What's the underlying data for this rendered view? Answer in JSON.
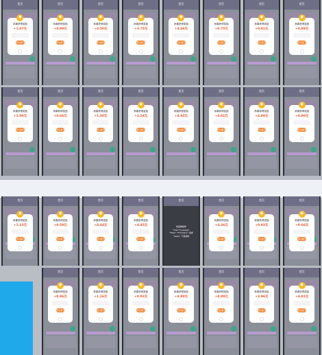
{
  "colors": {
    "bg": "#b9bdc4",
    "tile": "#8a8f99",
    "header": "#6e6f86",
    "card": "#ffffff",
    "amount": "#e8542b",
    "button": "#f28b3a",
    "coin": "#f7b928",
    "desktop": "#eef1f5",
    "blue": "#1fa8ea"
  },
  "rows": [
    {
      "tiles": [
        {
          "title": "首页",
          "card_title": "恭喜获得奖励",
          "amount": "+1.07元",
          "btn": "开心收下"
        },
        {
          "title": "首页",
          "card_title": "恭喜获得奖励",
          "amount": "+0.99元",
          "btn": "开心收下"
        },
        {
          "title": "首页",
          "card_title": "恭喜获得奖励",
          "amount": "+4.50元",
          "btn": "开心收下"
        },
        {
          "title": "首页",
          "card_title": "恭喜获得奖励",
          "amount": "+3.75元",
          "btn": "开心收下"
        },
        {
          "title": "首页",
          "card_title": "恭喜获得奖励",
          "amount": "+4.46元",
          "btn": "开心收下"
        },
        {
          "title": "首页",
          "card_title": "恭喜获得奖励",
          "amount": "+0.75元",
          "btn": "开心收下"
        },
        {
          "title": "首页",
          "card_title": "恭喜获得奖励",
          "amount": "+0.91元",
          "btn": "开心收下"
        },
        {
          "title": "首页",
          "card_title": "恭喜获得奖励",
          "amount": "+0.89元",
          "btn": "开心收下"
        }
      ]
    },
    {
      "tiles": [
        {
          "title": "首页",
          "card_title": "恭喜获得奖励",
          "amount": "+1.08元",
          "btn": "开心收下"
        },
        {
          "title": "首页",
          "card_title": "恭喜获得奖励",
          "amount": "+0.66元",
          "btn": "开心收下"
        },
        {
          "title": "首页",
          "card_title": "恭喜获得奖励",
          "amount": "+1.30元",
          "btn": "开心收下"
        },
        {
          "title": "首页",
          "card_title": "恭喜获得奖励",
          "amount": "+1.24元",
          "btn": "开心收下"
        },
        {
          "title": "首页",
          "card_title": "恭喜获得奖励",
          "amount": "+4.93元",
          "btn": "开心收下"
        },
        {
          "title": "首页",
          "card_title": "恭喜获得奖励",
          "amount": "+4.81元",
          "btn": "开心收下"
        },
        {
          "title": "首页",
          "card_title": "恭喜获得奖励",
          "amount": "+4.89元",
          "btn": "开心收下"
        },
        {
          "title": "首页",
          "card_title": "恭喜获得奖励",
          "amount": "+0.80元",
          "btn": "开心收下"
        }
      ]
    },
    {
      "tiles": [
        {
          "title": "首页",
          "card_title": "恭喜获得奖励",
          "amount": "+1.13元",
          "btn": "开心收下"
        },
        {
          "title": "首页",
          "card_title": "恭喜获得奖励",
          "amount": "+0.58元",
          "btn": "开心收下"
        },
        {
          "title": "首页",
          "card_title": "恭喜获得奖励",
          "amount": "+4.44元",
          "btn": "开心收下"
        },
        {
          "title": "首页",
          "card_title": "恭喜获得奖励",
          "amount": "+4.45元",
          "btn": "开心收下"
        },
        {
          "title": "首页",
          "dark": true,
          "tip_lines": [
            "请选择操作",
            "\"Trae\"\"hyeeage\"",
            "\"ToDo\" \"Firmware\" 请求",
            "\"Sales\" 下载资料"
          ]
        },
        {
          "title": "首页",
          "card_title": "恭喜获得奖励",
          "amount": "+4.26元",
          "btn": "开心收下"
        },
        {
          "title": "首页",
          "card_title": "恭喜获得奖励",
          "amount": "+0.92元",
          "btn": "开心收下"
        },
        {
          "title": "首页",
          "card_title": "恭喜获得奖励",
          "amount": "+0.66元",
          "btn": "开心收下"
        }
      ]
    },
    {
      "tiles": [
        null,
        {
          "title": "首页",
          "card_title": "恭喜获得奖励",
          "amount": "+0.86元",
          "btn": "开心收下"
        },
        {
          "title": "首页",
          "card_title": "恭喜获得奖励",
          "amount": "+1.16元",
          "btn": "开心收下"
        },
        {
          "title": "首页",
          "card_title": "恭喜获得奖励",
          "amount": "+0.93元",
          "btn": "开心收下"
        },
        {
          "title": "首页",
          "card_title": "恭喜获得奖励",
          "amount": "+4.80元",
          "btn": "开心收下"
        },
        {
          "title": "首页",
          "card_title": "恭喜获得奖励",
          "amount": "+4.80元",
          "btn": "开心收下"
        },
        {
          "title": "首页",
          "card_title": "恭喜获得奖励",
          "amount": "+3.96元",
          "btn": "开心收下"
        },
        {
          "title": "首页",
          "card_title": "恭喜获得奖励",
          "amount": "+4.81元",
          "btn": "开心收下"
        }
      ]
    }
  ]
}
